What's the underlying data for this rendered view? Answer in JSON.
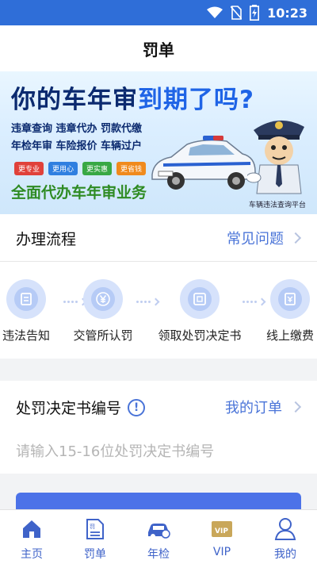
{
  "status_bar": {
    "time": "10:23"
  },
  "header": {
    "title": "罚单"
  },
  "banner": {
    "headline_part1": "你的车年审",
    "headline_part2": "到期了吗?",
    "services_line1": "违章查询 违章代办 罚款代缴",
    "services_line2": "年检年审 车险报价 车辆过户",
    "chips": [
      "更专业",
      "更用心",
      "更实惠",
      "更省钱"
    ],
    "subtitle": "全面代办车年审业务",
    "brand": "车辆违法查询平台"
  },
  "process": {
    "title": "办理流程",
    "faq_label": "常见问题",
    "steps": [
      {
        "label": "违法告知",
        "icon": "document-icon"
      },
      {
        "label": "交管所认罚",
        "icon": "yen-icon"
      },
      {
        "label": "领取处罚决定书",
        "icon": "certificate-icon"
      },
      {
        "label": "线上缴费",
        "icon": "payment-icon"
      }
    ]
  },
  "decision": {
    "label": "处罚决定书编号",
    "orders_label": "我的订单",
    "input_placeholder": "请输入15-16位处罚决定书编号",
    "input_value": ""
  },
  "tabs": [
    {
      "label": "主页",
      "icon": "home-icon"
    },
    {
      "label": "罚单",
      "icon": "ticket-icon"
    },
    {
      "label": "年检",
      "icon": "car-inspection-icon"
    },
    {
      "label": "VIP",
      "icon": "vip-icon"
    },
    {
      "label": "我的",
      "icon": "profile-icon"
    }
  ],
  "colors": {
    "status_bar": "#2f6ed8",
    "accent": "#4a74d8",
    "tab_icon": "#3f63c9",
    "submit": "#4c72e8"
  }
}
